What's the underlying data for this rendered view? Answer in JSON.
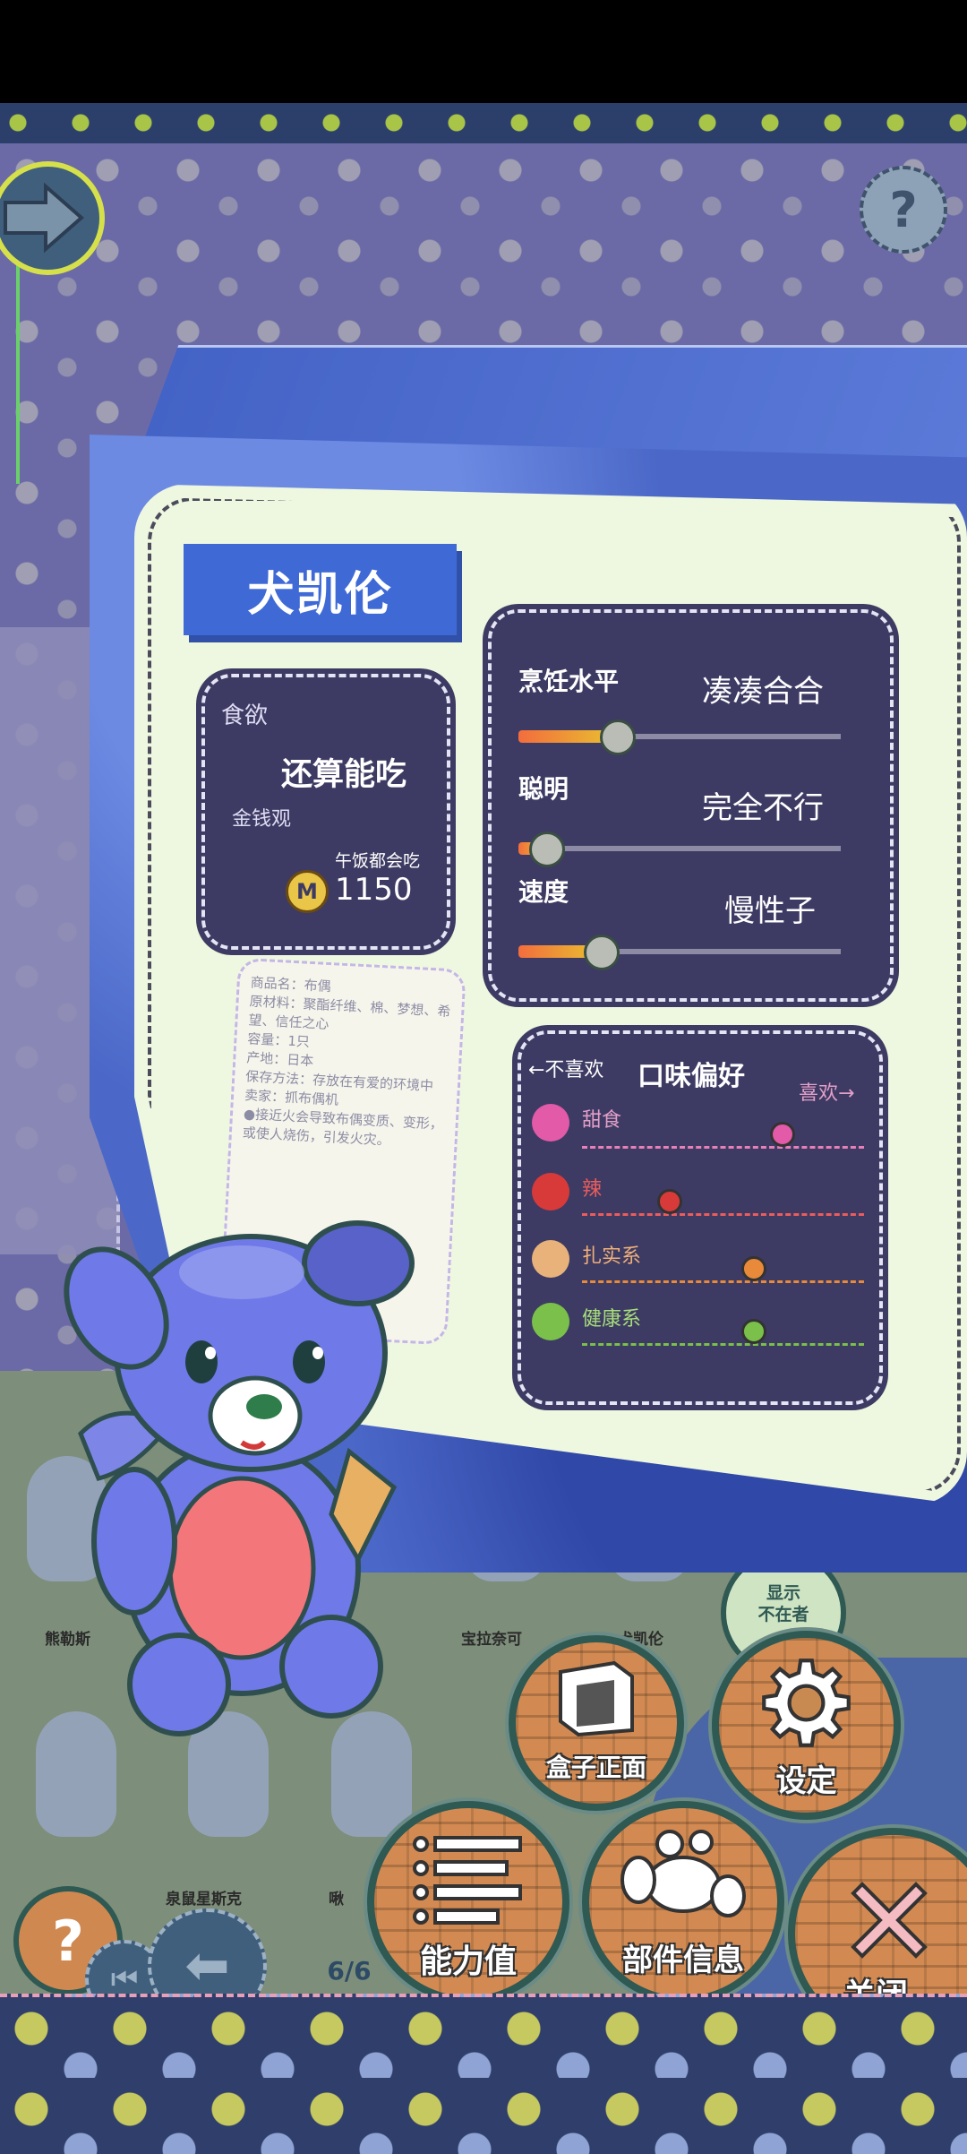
{
  "character": {
    "name": "犬凯伦"
  },
  "appetite": {
    "label": "食欲",
    "value": "还算能吃",
    "money_label": "金钱观",
    "money_value": "午饭都会吃",
    "coin_symbol": "M",
    "coin_amount": "1150"
  },
  "skills": [
    {
      "name": "烹饪水平",
      "value": "凑凑合合",
      "level": 0.3
    },
    {
      "name": "聪明",
      "value": "完全不行",
      "level": 0.08
    },
    {
      "name": "速度",
      "value": "慢性子",
      "level": 0.25
    }
  ],
  "taste": {
    "title": "口味偏好",
    "dislike": "←不喜欢",
    "like": "喜欢→",
    "items": [
      {
        "name": "甜食",
        "value": 0.7,
        "color": "#e25aa8"
      },
      {
        "name": "辣",
        "value": 0.3,
        "color": "#d83a3a"
      },
      {
        "name": "扎实系",
        "value": 0.6,
        "color": "#e88a3a"
      },
      {
        "name": "健康系",
        "value": 0.6,
        "color": "#7ac04a"
      }
    ]
  },
  "product_info": {
    "lines": [
      "商品名：布偶",
      "原材料：聚酯纤维、棉、梦想、希望、信任之心",
      "容量：1只",
      "产地：日本",
      "保存方法：存放在有爱的环境中",
      "卖家：抓布偶机",
      "●接近火会导致布偶变质、变形，或使人烧伤，引发火灾。"
    ]
  },
  "shelf": {
    "labels": [
      "熊勒斯",
      "宝拉奈可",
      "犬凯伦",
      "泉鼠星斯克",
      "啾"
    ],
    "badge_text": "显示\n不在者"
  },
  "buttons": {
    "box_front": "盒子正面",
    "settings": "设定",
    "stats": "能力值",
    "parts_info": "部件信息",
    "close": "关闭",
    "help": "?"
  },
  "pagination": {
    "indicator": "6/6"
  },
  "colors": {
    "panel": "#3d3b63",
    "card": "#eef7df",
    "banner": "#3f6ad6",
    "button_brick": "#d28a52",
    "button_ring": "#2f5953"
  }
}
